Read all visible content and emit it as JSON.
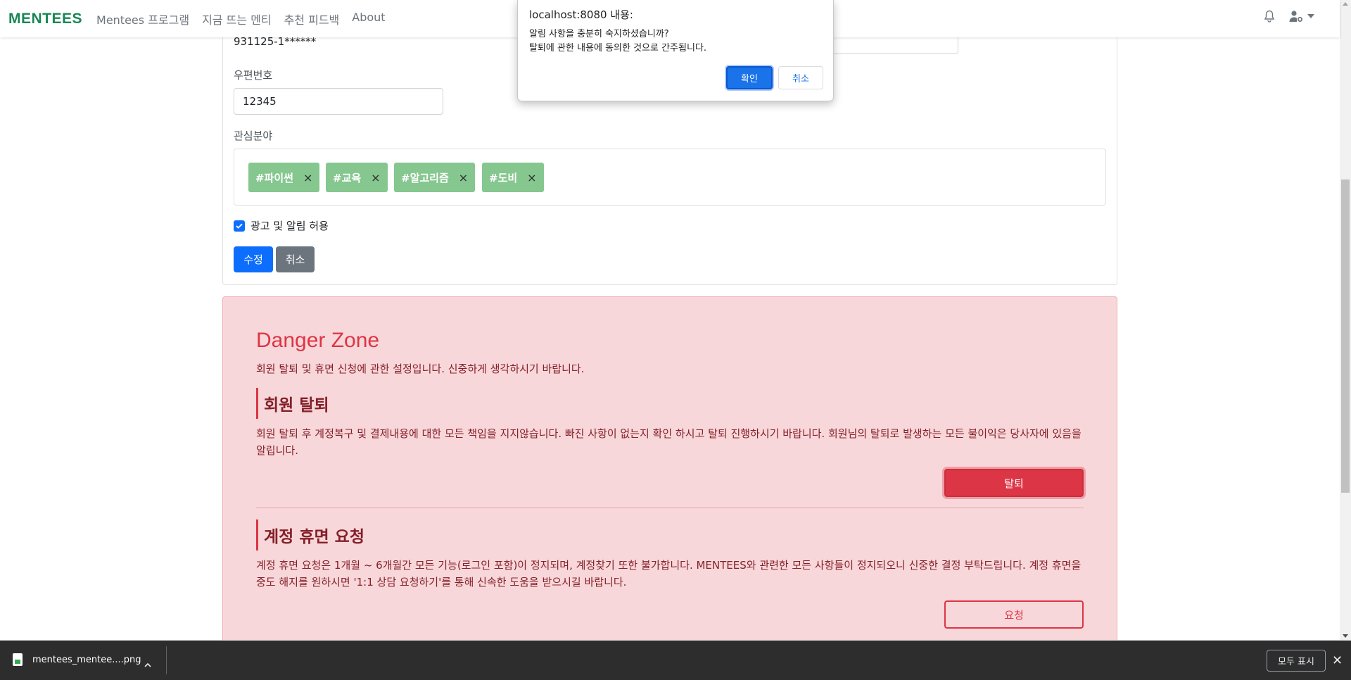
{
  "navbar": {
    "brand": "MENTEES",
    "links": [
      "Mentees 프로그램",
      "지금 뜨는 멘티",
      "추천 피드백",
      "About"
    ],
    "icons": [
      "bell-icon",
      "user-gear-icon",
      "chevron-down-icon"
    ]
  },
  "form": {
    "resident_number": "931125-1******",
    "zip_label": "우편번호",
    "zip_value": "12345",
    "interests_label": "관심분야",
    "tags": [
      "#파이썬",
      "#교육",
      "#알고리즘",
      "#도비"
    ],
    "tag_remove_glyph": "×",
    "ad_consent_label": "광고 및 알림 허용",
    "ad_consent_checked": true,
    "submit_label": "수정",
    "cancel_label": "취소"
  },
  "danger_zone": {
    "title": "Danger Zone",
    "subtitle": "회원 탈퇴 및 휴면 신청에 관한 설정입니다. 신중하게 생각하시기 바랍니다.",
    "withdraw": {
      "heading": "회원 탈퇴",
      "text": "회원 탈퇴 후 계정복구 및 결제내용에 대한 모든 책임을 지지않습니다. 빠진 사항이 없는지 확인 하시고 탈퇴 진행하시기 바랍니다. 회원님의 탈퇴로 발생하는 모든 불이익은 당사자에 있음을 알립니다.",
      "button": "탈퇴"
    },
    "dormant": {
      "heading": "계정 휴면 요청",
      "text": "계정 휴면 요청은 1개월 ~ 6개월간 모든 기능(로그인 포함)이 정지되며, 계정찾기 또한 불가합니다. MENTEES와 관련한 모든 사항들이 정지되오니 신중한 결정 부탁드립니다. 계정 휴면을 중도 해지를 원하시면 '1:1 상담 요청하기'를 통해 신속한 도움을 받으시길 바랍니다.",
      "button": "요청"
    }
  },
  "dialog": {
    "title": "localhost:8080 내용:",
    "message": "알림 사항을 충분히 숙지하셨습니까?\n탈퇴에 관한 내용에 동의한 것으로 간주됩니다.",
    "ok": "확인",
    "cancel": "취소"
  },
  "download_bar": {
    "filename": "mentees_mentee....png",
    "show_all": "모두 표시",
    "close_glyph": "✕"
  },
  "colors": {
    "brand": "#198754",
    "primary": "#0d6efd",
    "secondary": "#6c757d",
    "danger": "#dc3545",
    "danger_bg": "#f8d7da",
    "tag_bg": "#85c78f"
  }
}
